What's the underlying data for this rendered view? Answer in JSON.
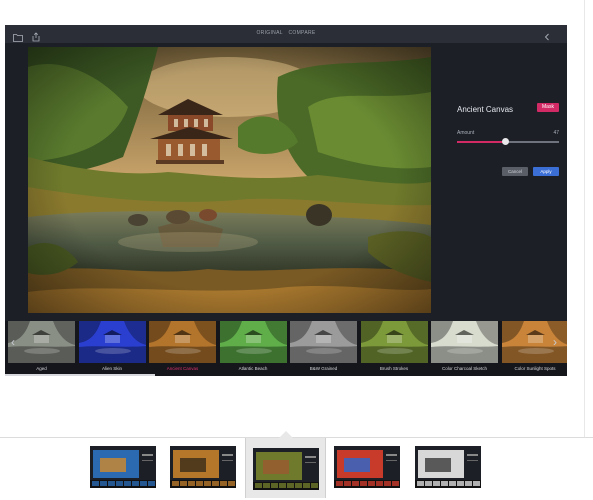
{
  "titlebar": {
    "original_label": "ORIGINAL",
    "compare_label": "COMPARE",
    "icons": [
      "folder-icon",
      "share-icon",
      "back-chevron-icon"
    ]
  },
  "panel": {
    "filter_name": "Ancient Canvas",
    "mask_label": "Mask",
    "amount_label": "Amount",
    "amount_value": "47",
    "amount_fraction": 0.47,
    "cancel_label": "Cancel",
    "apply_label": "Apply"
  },
  "filters": [
    {
      "label": "Aged",
      "tint": "#8a8f86",
      "active": false
    },
    {
      "label": "Alien Skin",
      "tint": "#2a3fd0",
      "active": false
    },
    {
      "label": "Ancient Canvas",
      "tint": "#b3742c",
      "active": true
    },
    {
      "label": "Atlantic Beach",
      "tint": "#5fae4a",
      "active": false
    },
    {
      "label": "B&W Grained",
      "tint": "#9b9b9b",
      "active": false
    },
    {
      "label": "Brush Strokes",
      "tint": "#7d9a3a",
      "active": false
    },
    {
      "label": "Color Charcoal Sketch",
      "tint": "#d8dccf",
      "active": false
    },
    {
      "label": "Color Sunlight Spots",
      "tint": "#c9843a",
      "active": false
    }
  ],
  "colors": {
    "accent": "#e0316d",
    "apply": "#3b6fd6",
    "app_bg": "#1c1f26"
  },
  "gallery": {
    "selected_index": 2,
    "thumbnails": [
      "screenshot-1",
      "screenshot-2",
      "screenshot-3",
      "screenshot-4",
      "screenshot-5"
    ]
  }
}
